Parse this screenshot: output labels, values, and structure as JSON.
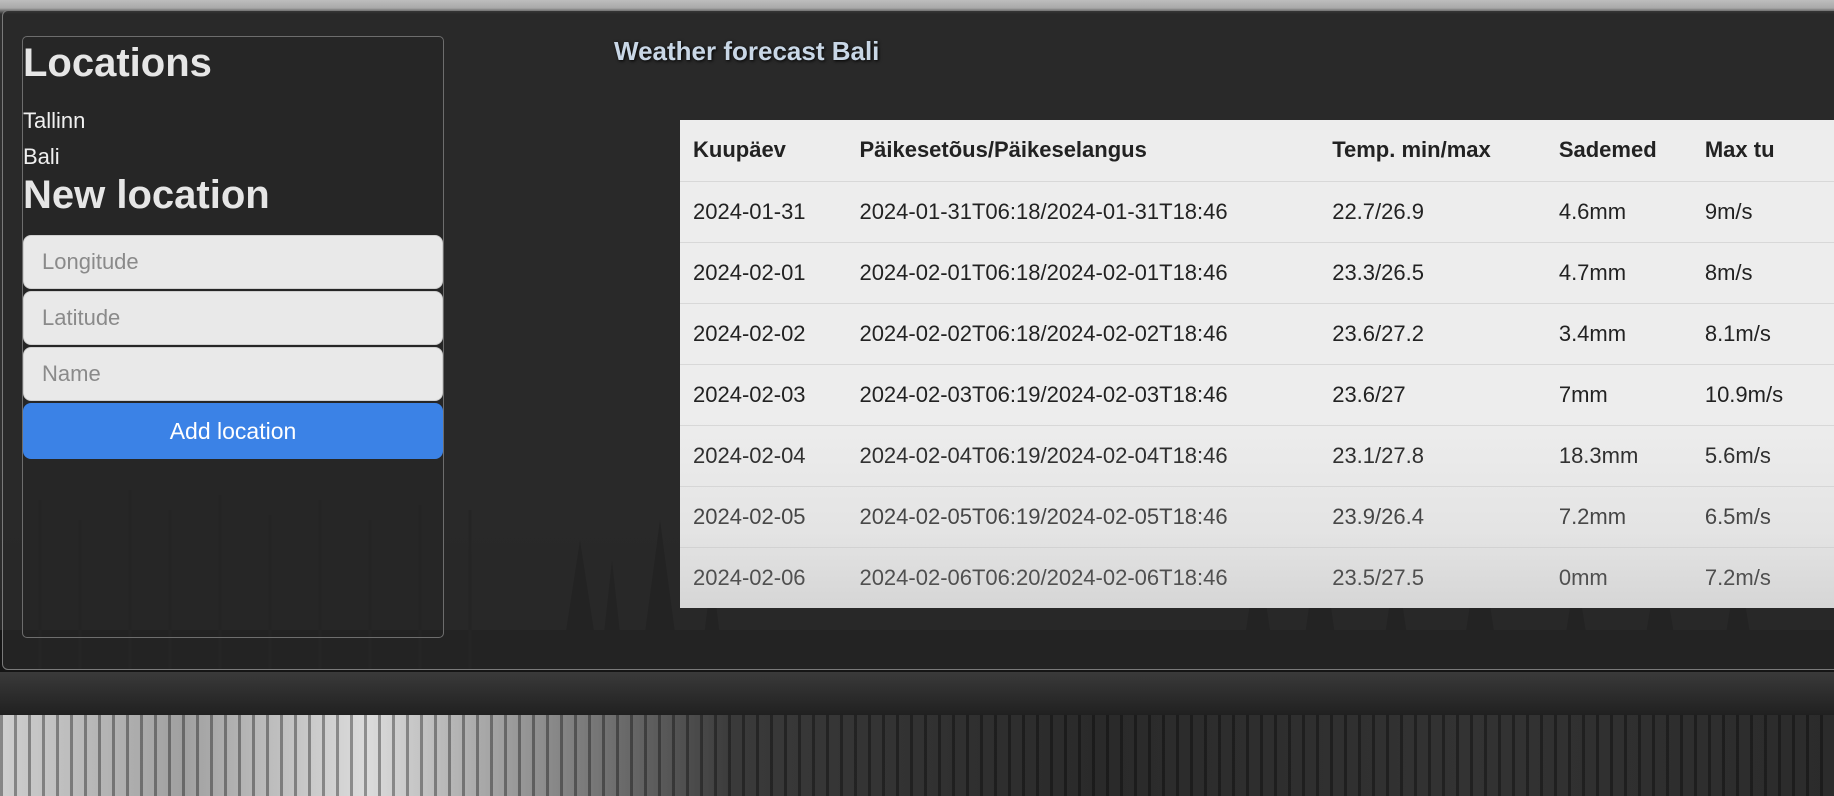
{
  "sidebar": {
    "title": "Locations",
    "locations": [
      "Tallinn",
      "Bali"
    ],
    "new_title": "New location",
    "longitude_placeholder": "Longitude",
    "latitude_placeholder": "Latitude",
    "name_placeholder": "Name",
    "add_button": "Add location"
  },
  "forecast": {
    "title": "Weather forecast Bali",
    "headers": [
      "Kuupäev",
      "Päikesetõus/Päikeselangus",
      "Temp. min/max",
      "Sademed",
      "Max tu"
    ],
    "rows": [
      [
        "2024-01-31",
        "2024-01-31T06:18/2024-01-31T18:46",
        "22.7/26.9",
        "4.6mm",
        "9m/s"
      ],
      [
        "2024-02-01",
        "2024-02-01T06:18/2024-02-01T18:46",
        "23.3/26.5",
        "4.7mm",
        "8m/s"
      ],
      [
        "2024-02-02",
        "2024-02-02T06:18/2024-02-02T18:46",
        "23.6/27.2",
        "3.4mm",
        "8.1m/s"
      ],
      [
        "2024-02-03",
        "2024-02-03T06:19/2024-02-03T18:46",
        "23.6/27",
        "7mm",
        "10.9m/s"
      ],
      [
        "2024-02-04",
        "2024-02-04T06:19/2024-02-04T18:46",
        "23.1/27.8",
        "18.3mm",
        "5.6m/s"
      ],
      [
        "2024-02-05",
        "2024-02-05T06:19/2024-02-05T18:46",
        "23.9/26.4",
        "7.2mm",
        "6.5m/s"
      ],
      [
        "2024-02-06",
        "2024-02-06T06:20/2024-02-06T18:46",
        "23.5/27.5",
        "0mm",
        "7.2m/s"
      ]
    ]
  },
  "colors": {
    "accent": "#3b82e6",
    "panel": "#282828",
    "title": "#c9d7e6"
  }
}
